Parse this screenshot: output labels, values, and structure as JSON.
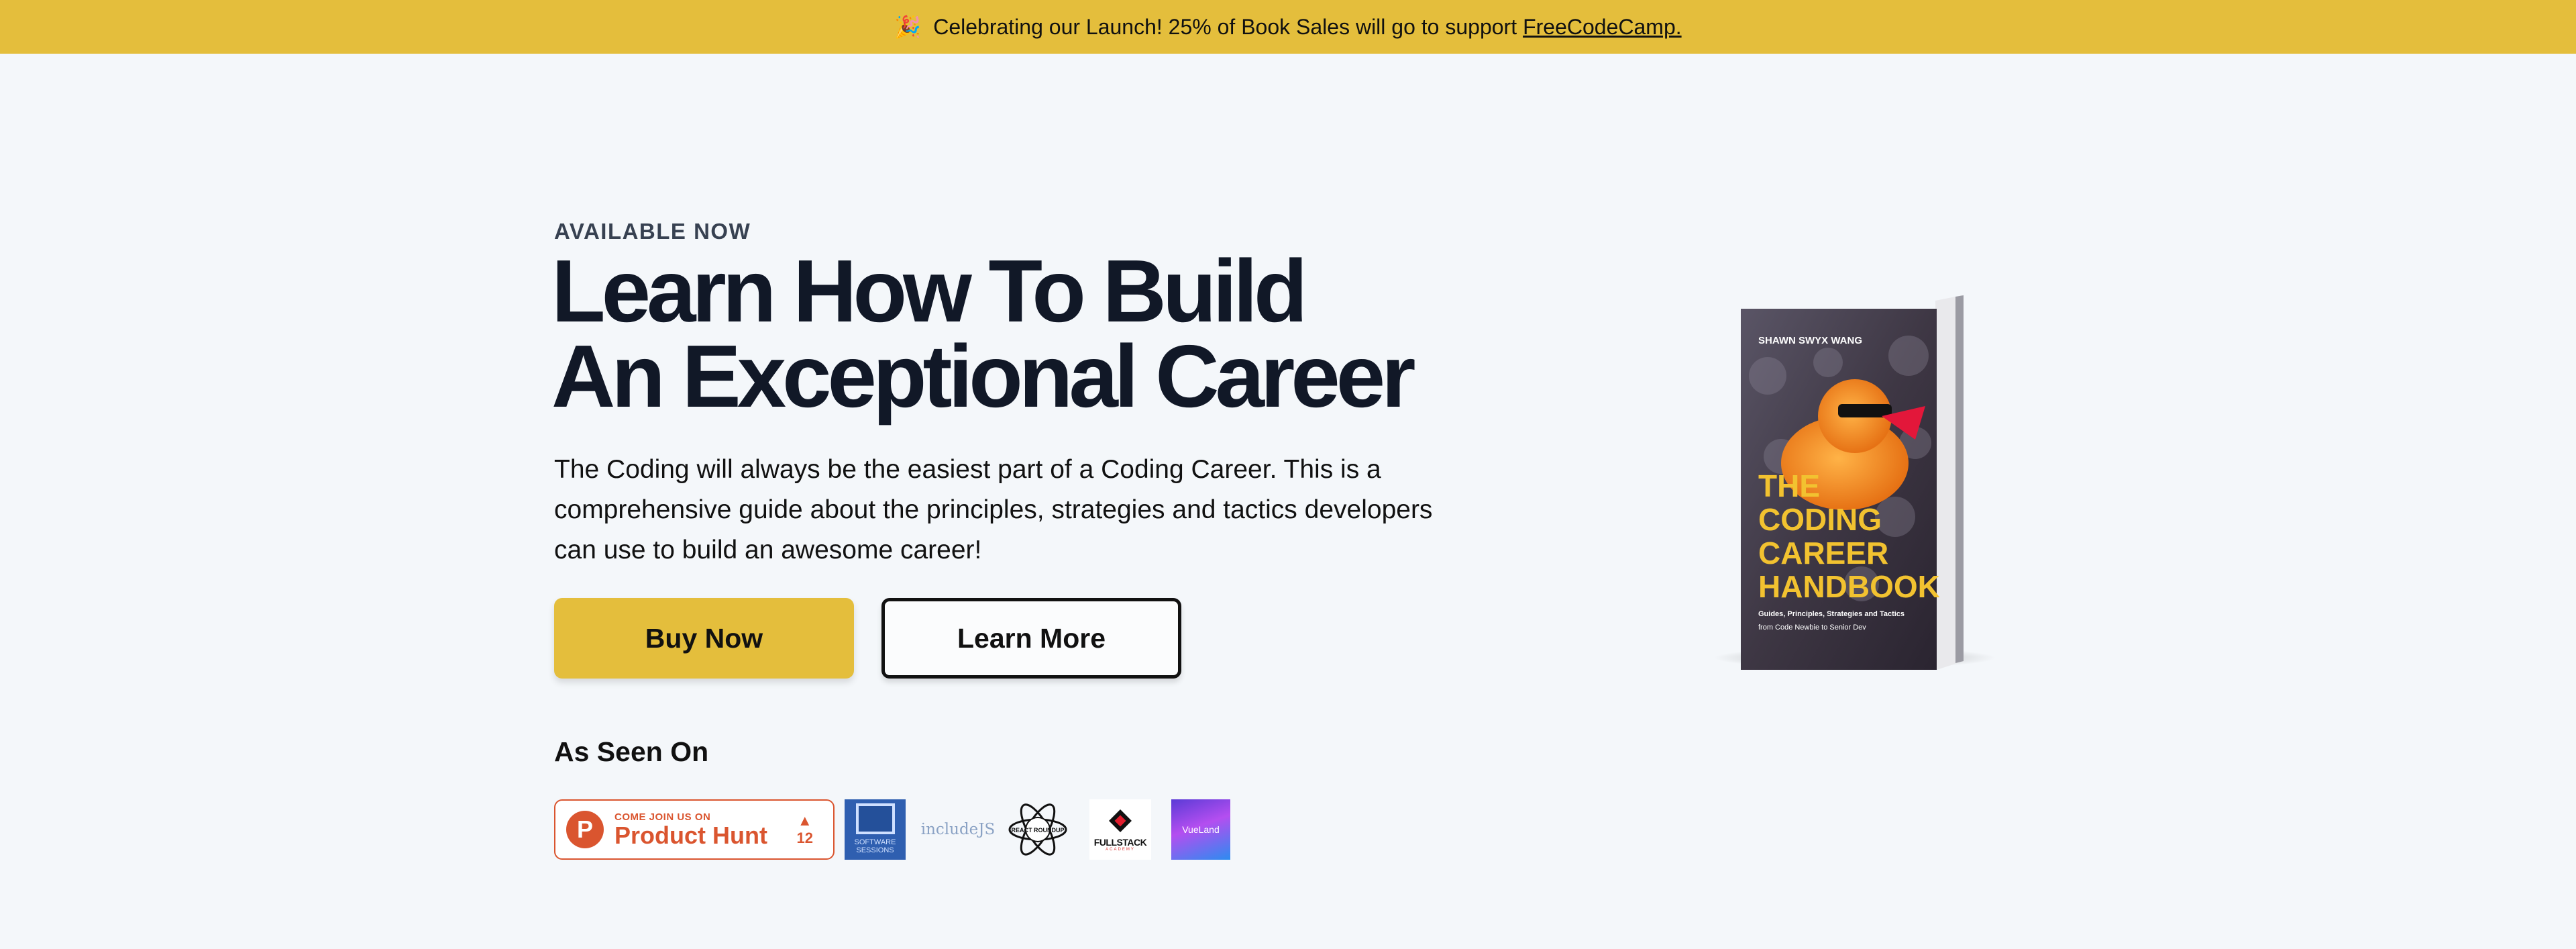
{
  "banner": {
    "emoji": "🎉",
    "text": "Celebrating our Launch! 25% of Book Sales will go to support",
    "link": "FreeCodeCamp."
  },
  "hero": {
    "eyebrow": "AVAILABLE NOW",
    "headline_line1": "Learn How To Build",
    "headline_line2": "An Exceptional Career",
    "lede": "The Coding will always be the easiest part of a Coding Career. This is a comprehensive guide about the principles, strategies and tactics developers can use to build an awesome career!",
    "buy_label": "Buy Now",
    "learn_label": "Learn More"
  },
  "seen_on": {
    "title": "As Seen On",
    "product_hunt": {
      "icon_letter": "P",
      "small": "COME JOIN US ON",
      "big": "Product Hunt",
      "arrow": "▲",
      "votes": "12"
    },
    "software_sessions": "SOFTWARE SESSIONS",
    "includejs": "includeJS",
    "react_label": "REACT ROUNDUP",
    "fullstack": "FULLSTACK",
    "fullstack_sub": "ACADEMY",
    "vue_label": "VueLand"
  },
  "book": {
    "author": "SHAWN SWYX WANG",
    "title_lines": [
      "THE",
      "CODING",
      "CAREER",
      "HANDBOOK"
    ],
    "subtitle1": "Guides, Principles, Strategies and Tactics",
    "subtitle2": "from Code Newbie to Senior Dev"
  },
  "colors": {
    "accent": "#e4be3c",
    "background": "#f4f7fa",
    "product_hunt": "#da552f"
  }
}
